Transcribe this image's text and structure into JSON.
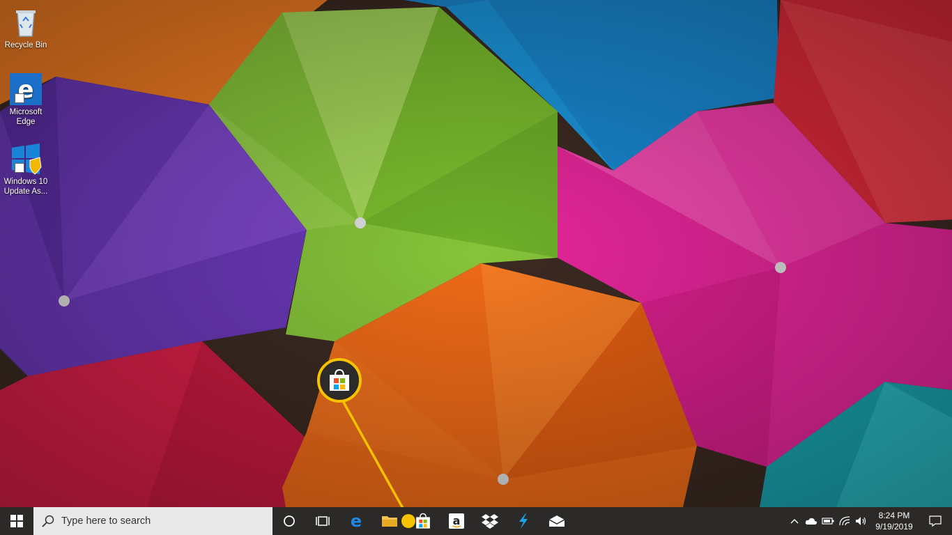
{
  "desktop": {
    "icons": [
      {
        "label": "Recycle Bin",
        "icon": "recycle-bin-icon"
      },
      {
        "label": "Microsoft\nEdge",
        "icon": "edge-icon"
      },
      {
        "label": "Windows 10\nUpdate As...",
        "icon": "windows-update-icon"
      }
    ]
  },
  "callout": {
    "icon": "microsoft-store-icon",
    "accent": "#f7c200"
  },
  "taskbar": {
    "background": "#2b2a29",
    "search": {
      "placeholder": "Type here to search"
    },
    "pinned": [
      {
        "name": "cortana",
        "icon": "cortana-circle-icon"
      },
      {
        "name": "task-view",
        "icon": "task-view-icon"
      },
      {
        "name": "edge",
        "icon": "edge-icon"
      },
      {
        "name": "file-explorer",
        "icon": "folder-icon"
      },
      {
        "name": "microsoft-store",
        "icon": "store-bag-icon"
      },
      {
        "name": "amazon",
        "icon": "amazon-icon"
      },
      {
        "name": "dropbox",
        "icon": "dropbox-icon"
      },
      {
        "name": "app",
        "icon": "lightning-icon"
      },
      {
        "name": "mail",
        "icon": "mail-icon"
      }
    ],
    "tray": {
      "time": "8:24 PM",
      "date": "9/19/2019"
    }
  }
}
